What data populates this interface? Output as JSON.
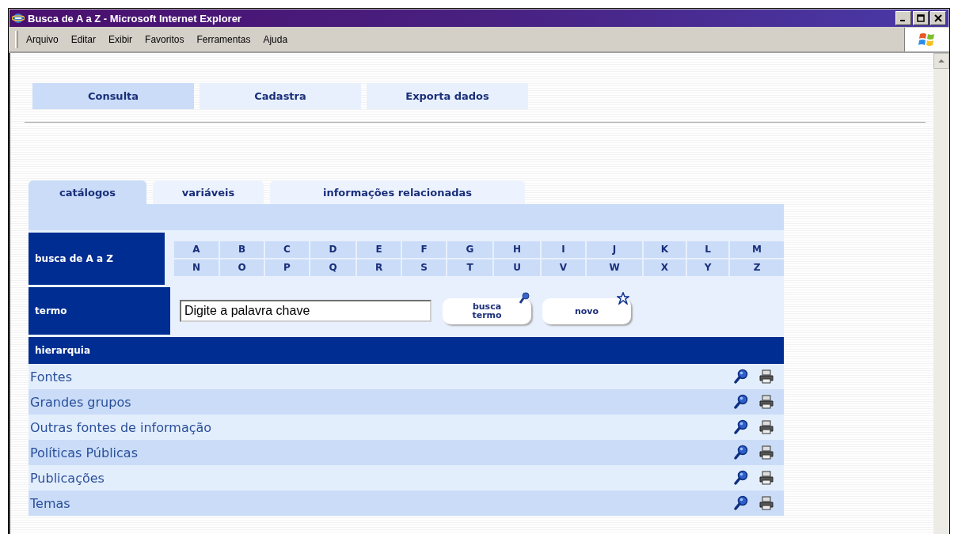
{
  "window": {
    "title": "Busca de A a Z - Microsoft Internet Explorer"
  },
  "menu": [
    "Arquivo",
    "Editar",
    "Exibir",
    "Favoritos",
    "Ferramentas",
    "Ajuda"
  ],
  "top_tabs": [
    {
      "label": "Consulta",
      "selected": true
    },
    {
      "label": "Cadastra",
      "selected": false
    },
    {
      "label": "Exporta dados",
      "selected": false
    }
  ],
  "tabs": [
    {
      "label": "catálogos",
      "selected": true
    },
    {
      "label": "variáveis",
      "selected": false
    },
    {
      "label": "informações relacionadas",
      "selected": false
    }
  ],
  "az": {
    "label": "busca de A a Z",
    "letters": [
      [
        "A",
        "B",
        "C",
        "D",
        "E",
        "F",
        "G",
        "H",
        "I",
        "J",
        "K",
        "L",
        "M"
      ],
      [
        "N",
        "O",
        "P",
        "Q",
        "R",
        "S",
        "T",
        "U",
        "V",
        "W",
        "X",
        "Y",
        "Z"
      ]
    ]
  },
  "term": {
    "label": "termo",
    "value": "Digite a palavra chave",
    "search_button": [
      "busca",
      "termo"
    ],
    "new_button": "novo"
  },
  "hierarchy": {
    "title": "hierarquia",
    "items": [
      "Fontes",
      "Grandes grupos",
      "Outras fontes de informação",
      "Políticas Públicas",
      "Publicações",
      "Temas"
    ]
  }
}
